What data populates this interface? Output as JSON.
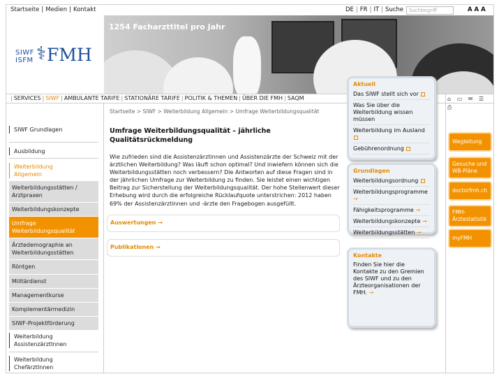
{
  "topbar": {
    "links": [
      "Startseite",
      "Medien",
      "Kontakt"
    ],
    "langs": [
      "DE",
      "FR",
      "IT",
      "Suche"
    ],
    "search_placeholder": "Suchbegriff",
    "font_sizes": "A A A"
  },
  "logo": {
    "line1": "SIWF",
    "line2": "ISFM",
    "symbol": "⚕",
    "brand": "FMH"
  },
  "hero": {
    "title": "1254 Facharzttitel pro Jahr"
  },
  "nav": {
    "items": [
      "SERVICES",
      "SIWF",
      "AMBULANTE TARIFE",
      "STATIONÄRE TARIFE",
      "POLITIK & THEMEN",
      "ÜBER DIE FMH",
      "SAQM"
    ],
    "active_index": 1,
    "icons": "⌂ ▭ ✉ ☰ ⎙"
  },
  "sidebar": {
    "top": [
      {
        "label": "SIWF Grundlagen"
      },
      {
        "label": "Ausbildung"
      },
      {
        "label": "Weiterbildung Allgemein"
      }
    ],
    "sub": [
      {
        "label": "Weiterbildungsstätten / Arztpraxen"
      },
      {
        "label": "Weiterbildungskonzepte"
      },
      {
        "label": "Umfrage Weiterbildungsqualität"
      },
      {
        "label": "Ärztedemographie an Weiterbildungsstätten"
      },
      {
        "label": "Röntgen"
      },
      {
        "label": "Militärdienst"
      },
      {
        "label": "Managementkurse"
      },
      {
        "label": "Komplementärmedizin"
      },
      {
        "label": "SIWF-Projektförderung"
      }
    ],
    "bottom": [
      {
        "label": "Weiterbildung AssistenzärztInnen"
      },
      {
        "label": "Weiterbildung ChefärztInnen"
      }
    ]
  },
  "content": {
    "breadcrumb": "Startseite > SIWF > Weiterbildung Allgemein > Umfrage Weiterbildungsqualität",
    "title": "Umfrage Weiterbildungsqualität – jährliche Qualitätsrückmeldung",
    "body": "Wie zufrieden sind die Assistenzärztinnen und Assistenzärzte der Schweiz mit der ärztlichen Weiterbildung? Was läuft schon optimal? Und inwiefern können sich die Weiterbildungsstätten noch verbessern? Die Antworten auf diese Fragen sind in der jährlichen Umfrage zur Weiterbildung zu finden. Sie leistet einen wichtigen Beitrag zur Sicherstellung der Weiterbildungsqualität. Der hohe Stellenwert dieser Erhebung wird durch die erfolgreiche Rücklaufquote unterstrichen: 2012 haben 69% der Assistenzärztinnen und -ärzte den Fragebogen ausgefüllt.",
    "boxes": [
      "Auswertungen",
      "Publikationen"
    ]
  },
  "aktuell": {
    "title": "Aktuell",
    "links": [
      "Das SIWF stellt sich vor",
      "Was Sie über die Weiterbildung wissen müssen",
      "Weiterbildung im Ausland",
      "Gebührenordnung"
    ]
  },
  "grundlagen": {
    "title": "Grundlagen",
    "links": [
      "Weiterbildungsordnung",
      "Weiterbildungsprogramme",
      "Fähigkeitsprogramme",
      "Weiterbildungskonzepte",
      "Weiterbildungsstätten"
    ]
  },
  "kontakte": {
    "title": "Kontakte",
    "text": "Finden Sie hier die Kontakte zu den Gremien des SIWF und zu den Ärzteorganisationen der FMH."
  },
  "right_buttons": [
    "Wegleitung",
    "Gesuche und WB-Pläne",
    "doctorfmh.ch",
    "FMH-Ärztestatistik",
    "myFMH"
  ],
  "colors": {
    "accent": "#f39200",
    "brand": "#1d4f9c"
  }
}
